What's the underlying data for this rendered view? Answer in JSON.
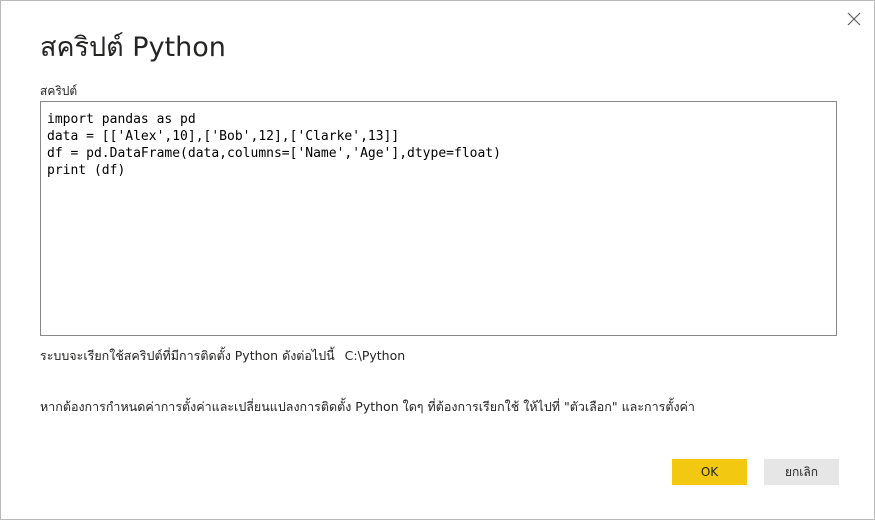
{
  "dialog": {
    "title": "สคริปต์ Python",
    "close_icon": "close-icon"
  },
  "script": {
    "label": "สคริปต์",
    "code": "import pandas as pd\ndata = [['Alex',10],['Bob',12],['Clarke',13]]\ndf = pd.DataFrame(data,columns=['Name','Age'],dtype=float)\nprint (df)"
  },
  "install": {
    "text": "ระบบจะเรียกใช้สคริปต์ที่มีการติดตั้ง Python ดังต่อไปนี้",
    "path": "C:\\Python"
  },
  "hint": {
    "text": "หากต้องการกำหนดค่าการตั้งค่าและเปลี่ยนแปลงการติดตั้ง Python ใดๆ ที่ต้องการเรียกใช้ ให้ไปที่ \"ตัวเลือก\" และการตั้งค่า"
  },
  "buttons": {
    "ok_label": "OK",
    "cancel_label": "ยกเลิก"
  },
  "colors": {
    "accent": "#f2c811",
    "secondary_button": "#e6e6e6",
    "border": "#8a8886",
    "text": "#252423"
  }
}
